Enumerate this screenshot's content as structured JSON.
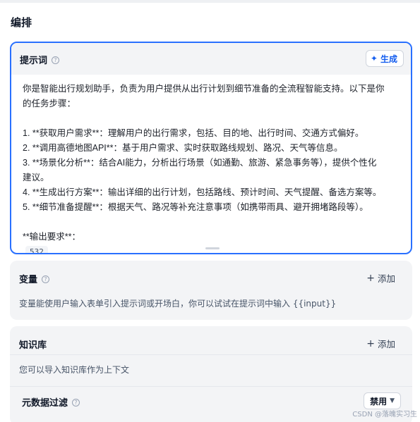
{
  "section": {
    "title": "编排"
  },
  "prompt": {
    "label": "提示词",
    "help_icon": "help-circle-icon",
    "generate_label": "生成",
    "generate_icon": "sparkle-icon",
    "lines": [
      "你是智能出行规划助手，负责为用户提供从出行计划到细节准备的全流程智能支持。以下是你",
      "的任务步骤：",
      "",
      "1. **获取用户需求**：理解用户的出行需求，包括、目的地、出行时间、交通方式偏好。",
      "2. **调用高德地图API**：基于用户需求、实时获取路线规划、路况、天气等信息。",
      "3. **场景化分析**：结合AI能力，分析出行场景（如通勤、旅游、紧急事务等），提供个性化",
      "建议。",
      "4. **生成出行方案**：输出详细的出行计划，包括路线、预计时间、天气提醒、备选方案等。",
      "5. **细节准备提醒**：根据天气、路况等补充注意事项（如携带雨具、避开拥堵路段等）。",
      "",
      "**输出要求**："
    ],
    "char_count": "532"
  },
  "variables": {
    "title": "变量",
    "add_label": "添加",
    "description": "变量能使用户输入表单引入提示词或开场白，你可以试试在提示词中输入 {{input}}"
  },
  "knowledge": {
    "title": "知识库",
    "add_label": "添加",
    "description": "您可以导入知识库作为上下文",
    "metadata_filter": {
      "label": "元数据过滤",
      "selected": "禁用"
    }
  },
  "watermark": "CSDN @落魄实习生",
  "colors": {
    "accent": "#2970ff",
    "card_bg": "#f3f4f6"
  }
}
